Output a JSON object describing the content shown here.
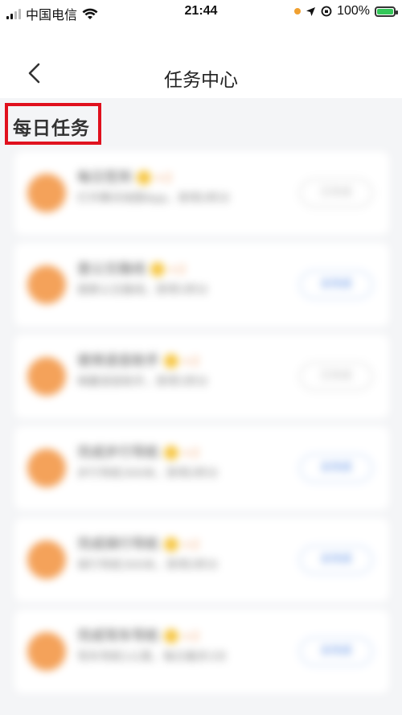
{
  "status_bar": {
    "carrier": "中国电信",
    "time": "21:44",
    "battery": "100%",
    "battery_level": 1.0
  },
  "header": {
    "title": "任务中心"
  },
  "section": {
    "title": "每日任务"
  },
  "tasks": [
    {
      "name": "每日签到",
      "reward": "+2",
      "desc": "打开腾讯地图App，获得2积分",
      "button": "已完成",
      "done": true
    },
    {
      "name": "查公交路线",
      "reward": "+2",
      "desc": "搜索公交路线，获得1积分",
      "button": "去完成",
      "done": false
    },
    {
      "name": "使用语音助手",
      "reward": "+2",
      "desc": "唤醒语音助手，获得1积分",
      "button": "已完成",
      "done": true
    },
    {
      "name": "完成步行导航",
      "reward": "+2",
      "desc": "步行导航300米，获得2积分",
      "button": "去完成",
      "done": false
    },
    {
      "name": "完成骑行导航",
      "reward": "+2",
      "desc": "骑行导航300米，获得2积分",
      "button": "去完成",
      "done": false
    },
    {
      "name": "完成驾车导航",
      "reward": "+2",
      "desc": "驾车导航1公里，每日最多3次",
      "button": "去完成",
      "done": false
    }
  ]
}
